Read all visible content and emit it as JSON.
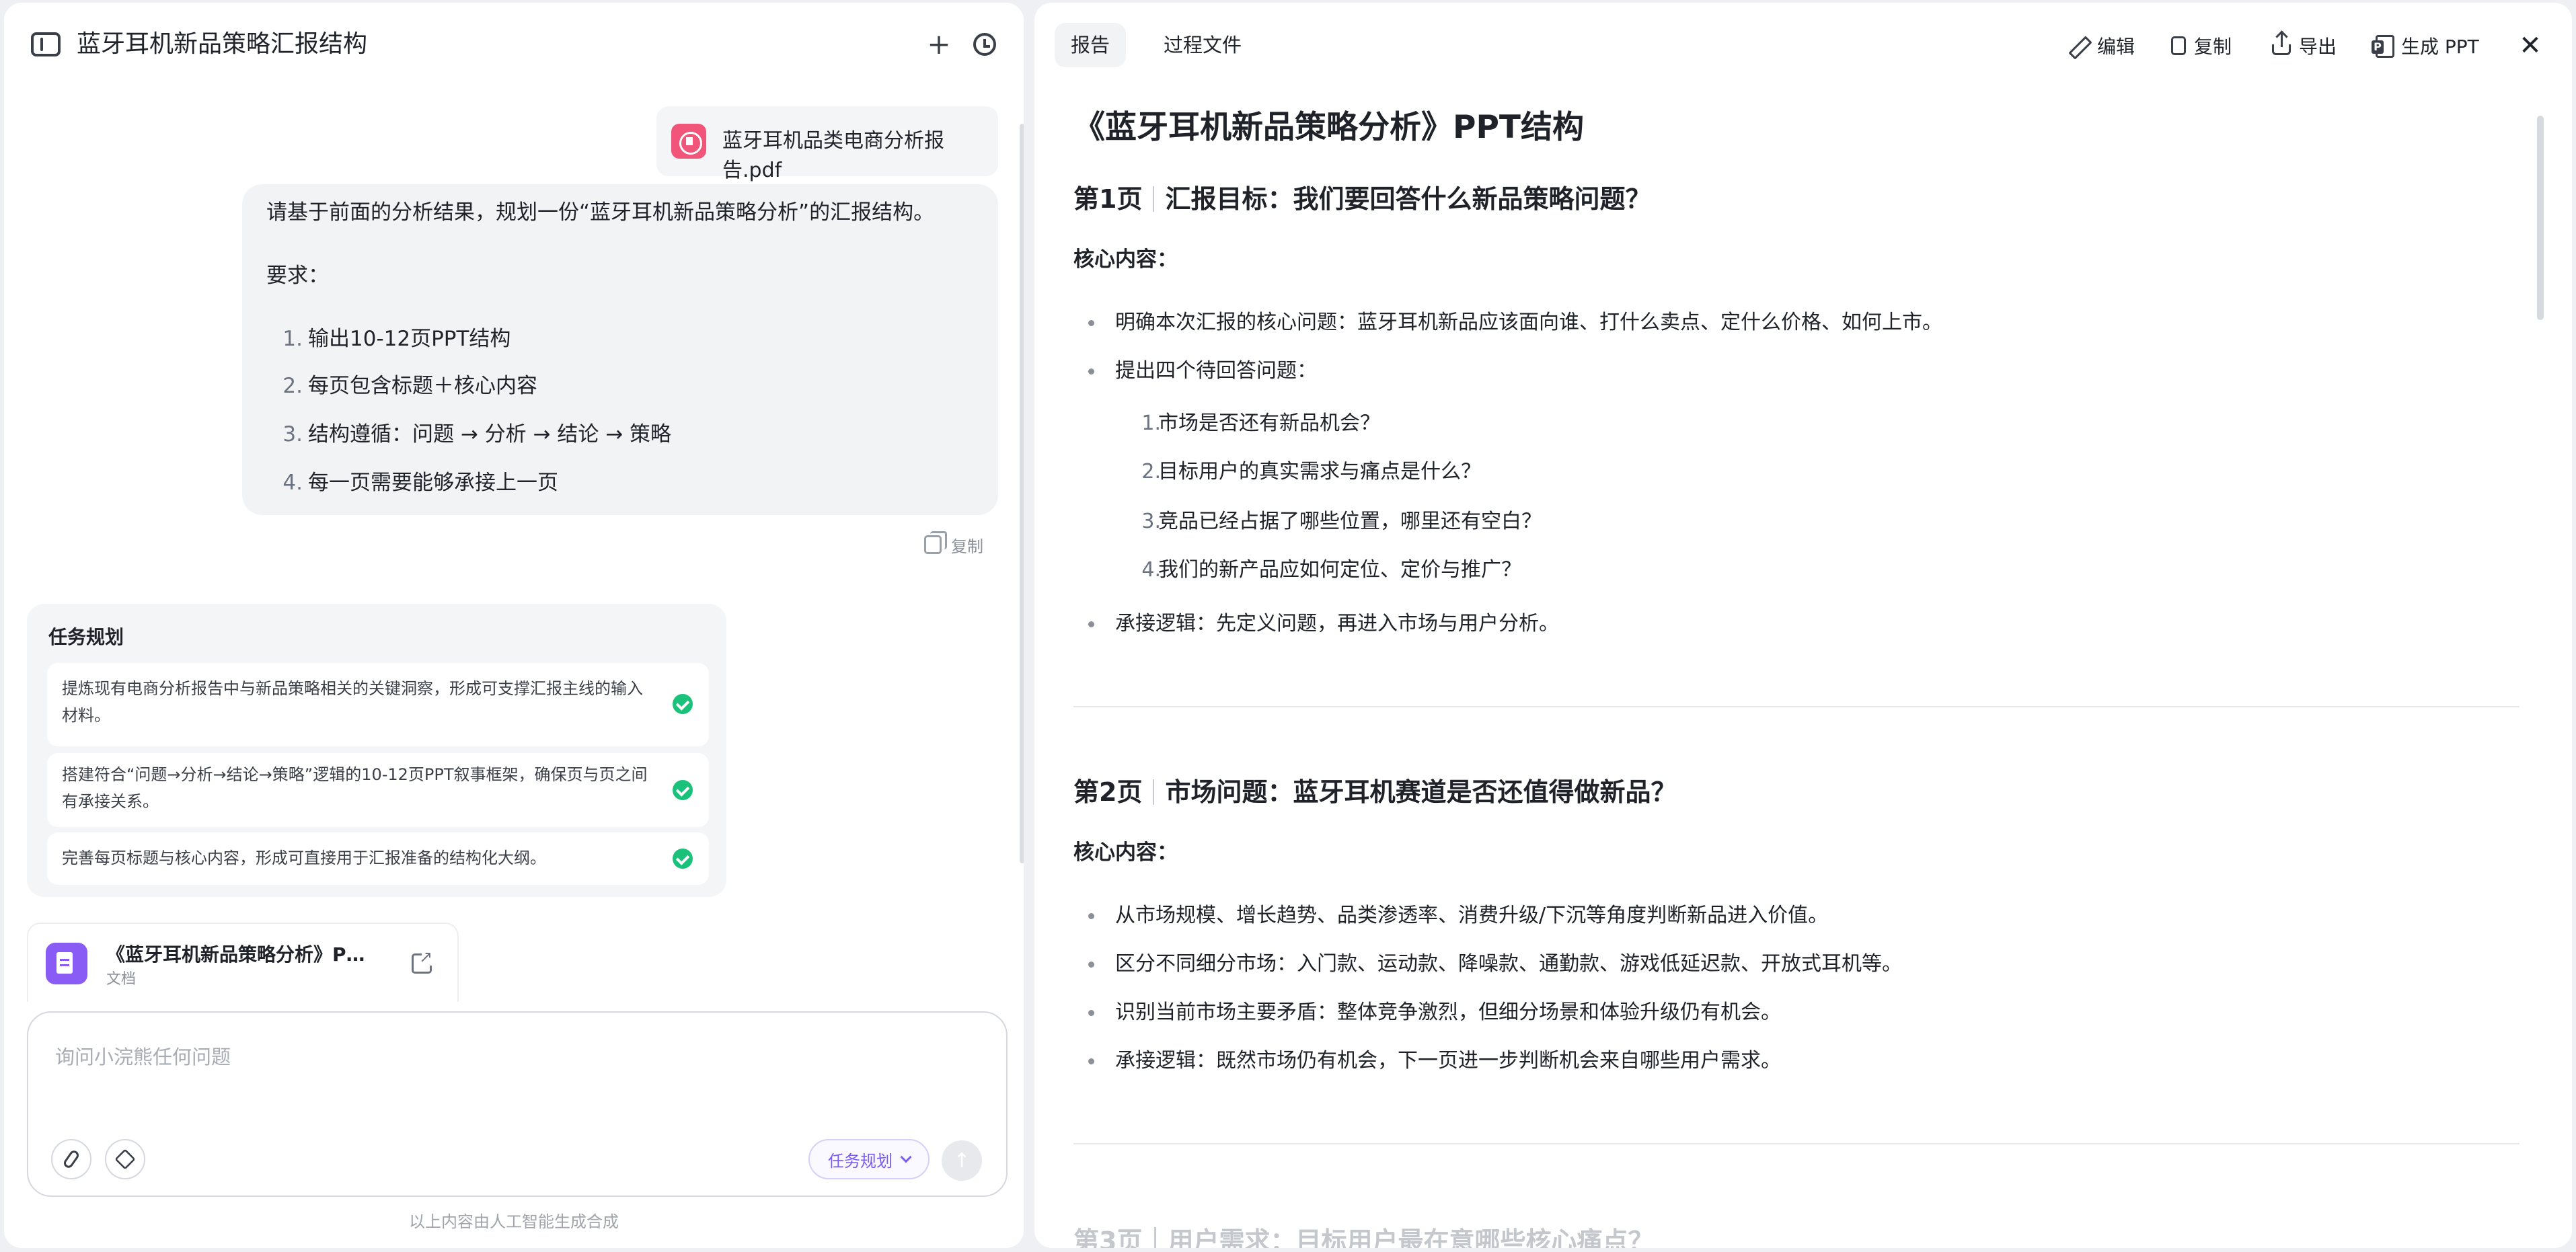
{
  "header": {
    "conversation_title": "蓝牙耳机新品策略汇报结构"
  },
  "attachment": {
    "file_name": "蓝牙耳机品类电商分析报告.pdf"
  },
  "user_message": {
    "intro": "请基于前面的分析结果，规划一份“蓝牙耳机新品策略分析”的汇报结构。",
    "requirements_label": "要求：",
    "items": [
      {
        "num": "1.",
        "text": "输出10-12页PPT结构"
      },
      {
        "num": "2.",
        "text": "每页包含标题＋核心内容"
      },
      {
        "num": "3.",
        "text": "结构遵循：问题 → 分析 → 结论 → 策略"
      },
      {
        "num": "4.",
        "text": "每一页需要能够承接上一页"
      }
    ],
    "copy_label": "复制"
  },
  "task_plan": {
    "title": "任务规划",
    "items": [
      {
        "text": "提炼现有电商分析报告中与新品策略相关的关键洞察，形成可支撑汇报主线的输入材料。",
        "status": "done"
      },
      {
        "text": "搭建符合“问题→分析→结论→策略”逻辑的10-12页PPT叙事框架，确保页与页之间有承接关系。",
        "status": "done"
      },
      {
        "text": "完善每页标题与核心内容，形成可直接用于汇报准备的结构化大纲。",
        "status": "done"
      }
    ]
  },
  "doc_card": {
    "title": "《蓝牙耳机新品策略分析》PPT结构",
    "type": "文档"
  },
  "composer": {
    "placeholder": "询问小浣熊任何问题",
    "mode_label": "任务规划",
    "send_glyph": "↑"
  },
  "disclaimer": "以上内容由人工智能生成合成",
  "right_panel": {
    "tabs": [
      {
        "label": "报告",
        "active": true
      },
      {
        "label": "过程文件",
        "active": false
      }
    ],
    "actions": {
      "edit": "编辑",
      "copy": "复制",
      "export": "导出",
      "generate_ppt": "生成 PPT"
    },
    "close_glyph": "✕"
  },
  "report": {
    "title": "《蓝牙耳机新品策略分析》PPT结构",
    "sections": [
      {
        "page": "第1页",
        "heading": "汇报目标：我们要回答什么新品策略问题？",
        "label": "核心内容：",
        "bullet1": "明确本次汇报的核心问题：蓝牙耳机新品应该面向谁、打什么卖点、定什么价格、如何上市。",
        "bullet2": "提出四个待回答问题：",
        "sub_items": [
          {
            "num": "1.",
            "text": "市场是否还有新品机会？"
          },
          {
            "num": "2.",
            "text": "目标用户的真实需求与痛点是什么？"
          },
          {
            "num": "3.",
            "text": "竞品已经占据了哪些位置，哪里还有空白？"
          },
          {
            "num": "4.",
            "text": "我们的新产品应如何定位、定价与推广？"
          }
        ],
        "bullet3": "承接逻辑：先定义问题，再进入市场与用户分析。"
      },
      {
        "page": "第2页",
        "heading": "市场问题：蓝牙耳机赛道是否还值得做新品？",
        "label": "核心内容：",
        "bullets": [
          "从市场规模、增长趋势、品类渗透率、消费升级/下沉等角度判断新品进入价值。",
          "区分不同细分市场：入门款、运动款、降噪款、通勤款、游戏低延迟款、开放式耳机等。",
          "识别当前市场主要矛盾：整体竞争激烈，但细分场景和体验升级仍有机会。",
          "承接逻辑：既然市场仍有机会，下一页进一步判断机会来自哪些用户需求。"
        ]
      }
    ],
    "faded_heading": "第3页｜用户需求：目标用户最在意哪些核心痛点？"
  }
}
